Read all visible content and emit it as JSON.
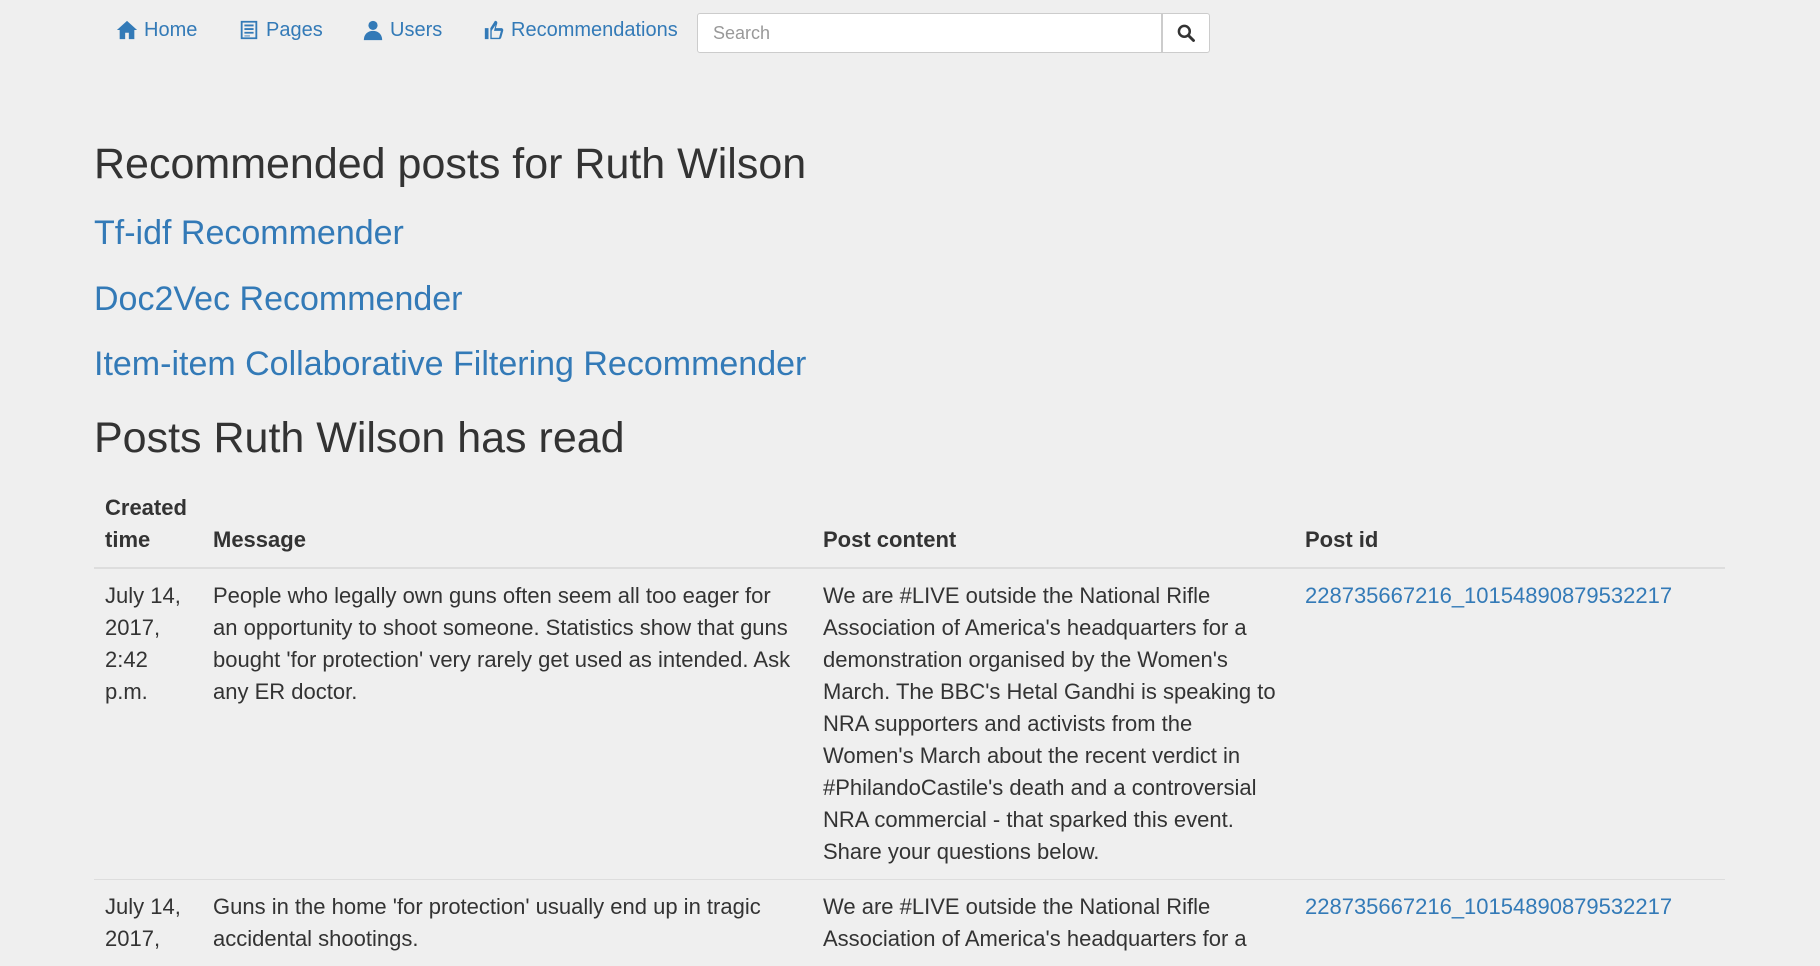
{
  "nav": {
    "home": "Home",
    "pages": "Pages",
    "users": "Users",
    "recommendations": "Recommendations",
    "search_placeholder": "Search"
  },
  "page_title": "Recommended posts for Ruth Wilson",
  "recommenders": [
    "Tf-idf Recommender",
    "Doc2Vec Recommender",
    "Item-item Collaborative Filtering Recommender"
  ],
  "read_section_title": "Posts Ruth Wilson has read",
  "table": {
    "headers": [
      "Created time",
      "Message",
      "Post content",
      "Post id"
    ],
    "rows": [
      {
        "created": "July 14, 2017, 2:42 p.m.",
        "message": "People who legally own guns often seem all too eager for an opportunity to shoot someone. Statistics show that guns bought 'for protection' very rarely get used as intended. Ask any ER doctor.",
        "content": "We are #LIVE outside the National Rifle Association of America's headquarters for a demonstration organised by the Women's March. The BBC's Hetal Gandhi is speaking to NRA supporters and activists from the Women's March about the recent verdict in #PhilandoCastile's death and a controversial NRA commercial - that sparked this event. Share your questions below.",
        "post_id": "228735667216_10154890879532217"
      },
      {
        "created": "July 14, 2017,",
        "message": "Guns in the home 'for protection' usually end up in tragic accidental shootings.",
        "content": "We are #LIVE outside the National Rifle Association of America's headquarters for a",
        "post_id": "228735667216_10154890879532217"
      }
    ]
  }
}
